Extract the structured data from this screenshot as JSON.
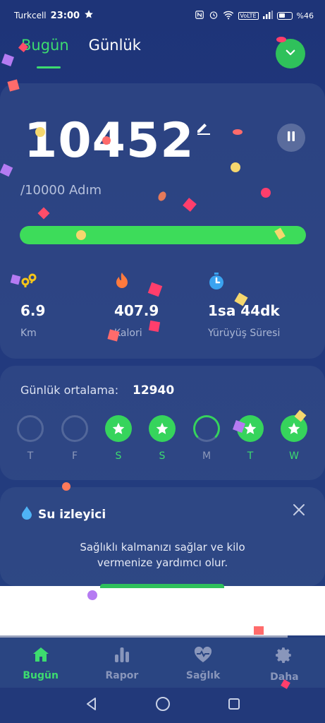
{
  "status_bar": {
    "carrier": "Turkcell",
    "time": "23:00",
    "battery": "%46",
    "network": "VoLTE"
  },
  "header": {
    "tabs": [
      {
        "label": "Bugün",
        "active": true
      },
      {
        "label": "Günlük",
        "active": false
      }
    ]
  },
  "steps": {
    "count": "10452",
    "goal": "/10000 Adım",
    "progress": 1.0
  },
  "stats": [
    {
      "icon": "route-icon",
      "value": "6.9",
      "label": "Km"
    },
    {
      "icon": "flame-icon",
      "value": "407.9",
      "label": "Kalori"
    },
    {
      "icon": "stopwatch-icon",
      "value": "1sa 44dk",
      "label": "Yürüyüş Süresi"
    }
  ],
  "daily_average": {
    "label": "Günlük ortalama:",
    "value": "12940"
  },
  "week": [
    {
      "day": "T",
      "status": "empty"
    },
    {
      "day": "F",
      "status": "empty"
    },
    {
      "day": "S",
      "status": "done"
    },
    {
      "day": "S",
      "status": "done"
    },
    {
      "day": "M",
      "status": "partial"
    },
    {
      "day": "T",
      "status": "done"
    },
    {
      "day": "W",
      "status": "done"
    }
  ],
  "water": {
    "title": "Su izleyici",
    "description_line1": "Sağlıklı kalmanızı sağlar ve kilo",
    "description_line2": "vermenize yardımcı olur."
  },
  "bottom_nav": [
    {
      "label": "Bugün",
      "icon": "home-icon",
      "active": true
    },
    {
      "label": "Rapor",
      "icon": "bar-chart-icon",
      "active": false
    },
    {
      "label": "Sağlık",
      "icon": "heart-pulse-icon",
      "active": false
    },
    {
      "label": "Daha",
      "icon": "gear-icon",
      "active": false
    }
  ],
  "colors": {
    "accent": "#3ddc6f",
    "background": "#1e3478"
  }
}
